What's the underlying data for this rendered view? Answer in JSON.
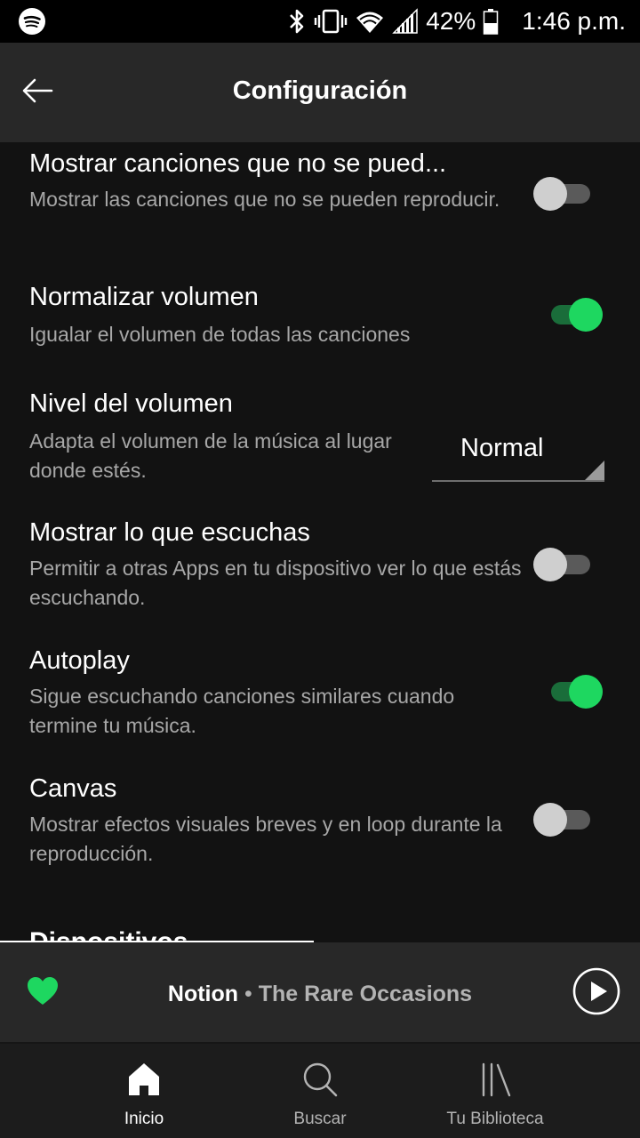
{
  "status_bar": {
    "battery": "42%",
    "time": "1:46 p.m."
  },
  "header": {
    "title": "Configuración"
  },
  "settings": [
    {
      "title": "Mostrar canciones que no se pued...",
      "description": "Mostrar las canciones que no se pueden reproducir.",
      "toggle_on": false
    },
    {
      "title": "Normalizar volumen",
      "description": "Igualar el volumen de todas las canciones",
      "toggle_on": true
    },
    {
      "title": "Nivel del volumen",
      "description": "Adapta el volumen de la música al lugar donde estés.",
      "selected_value": "Normal"
    },
    {
      "title": "Mostrar lo que escuchas",
      "description": "Permitir a otras Apps en tu dispositivo ver lo que estás escuchando.",
      "toggle_on": false
    },
    {
      "title": "Autoplay",
      "description": "Sigue escuchando canciones similares cuando termine tu música.",
      "toggle_on": true
    },
    {
      "title": "Canvas",
      "description": "Mostrar efectos visuales breves y en loop durante la reproducción.",
      "toggle_on": false
    }
  ],
  "next_section": "Dispositivos",
  "now_playing": {
    "title": "Notion",
    "separator": "•",
    "artist": "The Rare Occasions",
    "liked": true,
    "progress": 0.49
  },
  "nav": [
    {
      "label": "Inicio",
      "icon": "home-icon",
      "active": true
    },
    {
      "label": "Buscar",
      "icon": "search-icon",
      "active": false
    },
    {
      "label": "Tu Biblioteca",
      "icon": "library-icon",
      "active": false
    }
  ],
  "colors": {
    "accent_green": "#1ed760",
    "background": "#121212",
    "header": "#282828"
  }
}
